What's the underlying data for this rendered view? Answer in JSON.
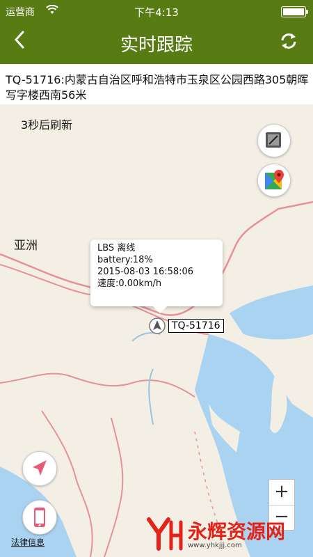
{
  "status_bar": {
    "carrier": "运营商",
    "time": "下午4:13"
  },
  "nav": {
    "back_symbol": "‹",
    "title": "实时跟踪"
  },
  "address": {
    "text": "TQ-51716:内蒙古自治区呼和浩特市玉泉区公园西路305朝晖写字楼西南56米"
  },
  "map": {
    "countdown": "3秒后刷新",
    "region_label": "亚洲",
    "popup_lines": [
      "LBS 离线",
      "battery:18%",
      "2015-08-03 16:58:06",
      "速度:0.00km/h"
    ],
    "device_label": "TQ-51716",
    "zoom_in": "+",
    "zoom_out": "−",
    "legal_link": "法律信息"
  },
  "watermark": {
    "text": "永辉资源网",
    "url": "www.yhkjjj.com"
  },
  "colors": {
    "nav_bg": "#587c13",
    "map_bg": "#f3efe5",
    "border_red": "#e8909a",
    "water": "#a9d3f0",
    "accent_pink": "#e85a78"
  },
  "icons": [
    "wifi-icon",
    "battery-icon",
    "back-arrow-icon",
    "refresh-icon",
    "satellite-layer-icon",
    "google-maps-icon",
    "navigate-icon",
    "phone-icon",
    "location-marker-icon"
  ]
}
